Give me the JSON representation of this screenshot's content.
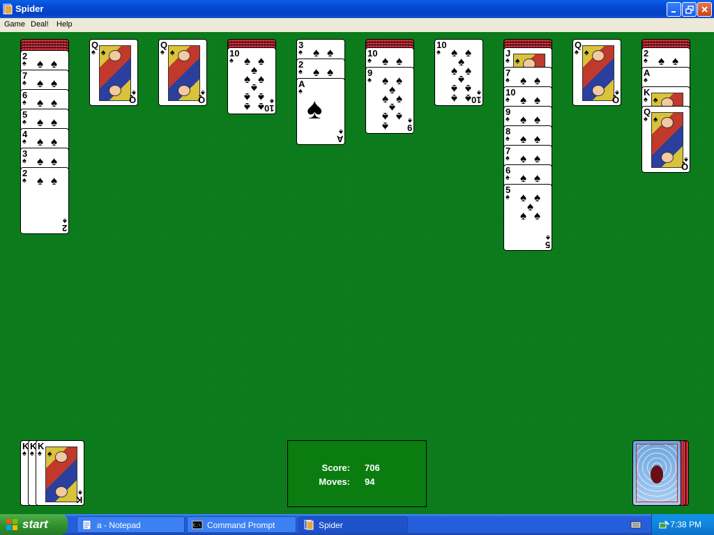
{
  "window": {
    "title": "Spider"
  },
  "menu": [
    "Game",
    "Deal!",
    "Help"
  ],
  "columns": [
    {
      "hidden": 4,
      "cards": [
        "2",
        "7",
        "6",
        "5",
        "4",
        "3",
        "2"
      ]
    },
    {
      "hidden": 0,
      "cards": [
        "Q"
      ]
    },
    {
      "hidden": 0,
      "cards": [
        "Q"
      ]
    },
    {
      "hidden": 3,
      "cards": [
        "10"
      ]
    },
    {
      "hidden": 0,
      "cards": [
        "3",
        "2",
        "A"
      ]
    },
    {
      "hidden": 3,
      "cards": [
        "10",
        "9"
      ]
    },
    {
      "hidden": 0,
      "cards": [
        "10"
      ]
    },
    {
      "hidden": 3,
      "cards": [
        "J",
        "7",
        "10",
        "9",
        "8",
        "7",
        "6",
        "5"
      ]
    },
    {
      "hidden": 0,
      "cards": [
        "Q"
      ]
    },
    {
      "hidden": 3,
      "cards": [
        "2",
        "A",
        "K",
        "Q"
      ]
    }
  ],
  "suit_symbol": "♠",
  "completed_stack": [
    "K",
    "K",
    "K"
  ],
  "score": {
    "score_label": "Score:",
    "score_value": "706",
    "moves_label": "Moves:",
    "moves_value": "94"
  },
  "taskbar": {
    "start_label": "start",
    "tasks": [
      {
        "label": "a - Notepad",
        "icon": "notepad-icon"
      },
      {
        "label": "Command Prompt",
        "icon": "cmd-icon"
      },
      {
        "label": "Spider",
        "icon": "spider-icon"
      }
    ],
    "clock": "7:38 PM"
  },
  "colors": {
    "felt": "#0d7d1d",
    "card_back": "#b3202e",
    "taskbar": "#245edb"
  }
}
